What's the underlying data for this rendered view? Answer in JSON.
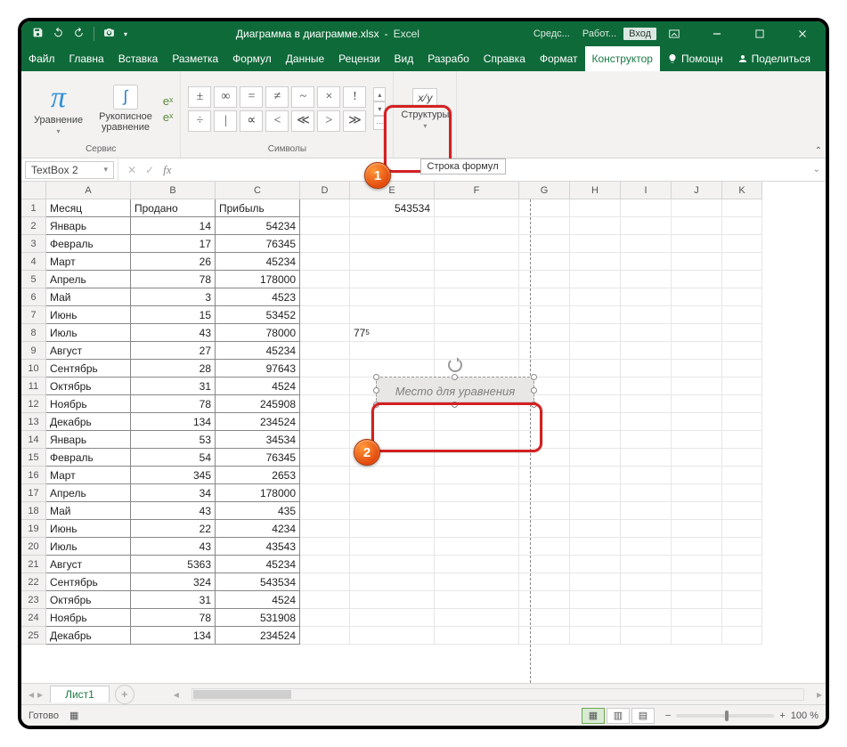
{
  "title": {
    "filename": "Диаграмма в диаграмме.xlsx",
    "app": "Excel"
  },
  "caps": {
    "c1": "Средс...",
    "c2": "Работ...",
    "login": "Вход"
  },
  "tabs": {
    "file": "Файл",
    "home": "Главна",
    "insert": "Вставка",
    "layout": "Разметка",
    "formulas": "Формул",
    "data": "Данные",
    "review": "Рецензи",
    "view": "Вид",
    "dev": "Разрабо",
    "help": "Справка",
    "format": "Формат",
    "design": "Конструктор",
    "tell": "Помощн",
    "share": "Поделиться"
  },
  "ribbon": {
    "equation": "Уравнение",
    "ink": "Рукописное\nуравнение",
    "service": "Сервис",
    "symbols": "Символы",
    "structures": "Структуры",
    "fraction_icon": "x⁄y",
    "syms": [
      "±",
      "∞",
      "=",
      "≠",
      "~",
      "×",
      "!",
      "÷",
      "|",
      "∝",
      "<",
      "≪",
      ">",
      "≫"
    ]
  },
  "formula": {
    "name": "TextBox 2",
    "fx": "fx",
    "tooltip": "Строка формул"
  },
  "cols": [
    "A",
    "B",
    "C",
    "D",
    "E",
    "F",
    "G",
    "H",
    "I",
    "J",
    "K"
  ],
  "hdr": {
    "a": "Месяц",
    "b": "Продано",
    "c": "Прибыль"
  },
  "e1": "543534",
  "e8": "77",
  "e8sup": "5",
  "rows": [
    {
      "a": "Январь",
      "b": 14,
      "c": 54234
    },
    {
      "a": "Февраль",
      "b": 17,
      "c": 76345
    },
    {
      "a": "Март",
      "b": 26,
      "c": 45234
    },
    {
      "a": "Апрель",
      "b": 78,
      "c": 178000
    },
    {
      "a": "Май",
      "b": 3,
      "c": 4523
    },
    {
      "a": "Июнь",
      "b": 15,
      "c": 53452
    },
    {
      "a": "Июль",
      "b": 43,
      "c": 78000
    },
    {
      "a": "Август",
      "b": 27,
      "c": 45234
    },
    {
      "a": "Сентябрь",
      "b": 28,
      "c": 97643
    },
    {
      "a": "Октябрь",
      "b": 31,
      "c": 4524
    },
    {
      "a": "Ноябрь",
      "b": 78,
      "c": 245908
    },
    {
      "a": "Декабрь",
      "b": 134,
      "c": 234524
    },
    {
      "a": "Январь",
      "b": 53,
      "c": 34534
    },
    {
      "a": "Февраль",
      "b": 54,
      "c": 76345
    },
    {
      "a": "Март",
      "b": 345,
      "c": 2653
    },
    {
      "a": "Апрель",
      "b": 34,
      "c": 178000
    },
    {
      "a": "Май",
      "b": 43,
      "c": 435
    },
    {
      "a": "Июнь",
      "b": 22,
      "c": 4234
    },
    {
      "a": "Июль",
      "b": 43,
      "c": 43543
    },
    {
      "a": "Август",
      "b": 5363,
      "c": 45234
    },
    {
      "a": "Сентябрь",
      "b": 324,
      "c": 543534
    },
    {
      "a": "Октябрь",
      "b": 31,
      "c": 4524
    },
    {
      "a": "Ноябрь",
      "b": 78,
      "c": 531908
    },
    {
      "a": "Декабрь",
      "b": 134,
      "c": 234524
    }
  ],
  "eq_placeholder": "Место для уравнения",
  "sheet": "Лист1",
  "status": {
    "ready": "Готово",
    "zoom": "100 %"
  }
}
